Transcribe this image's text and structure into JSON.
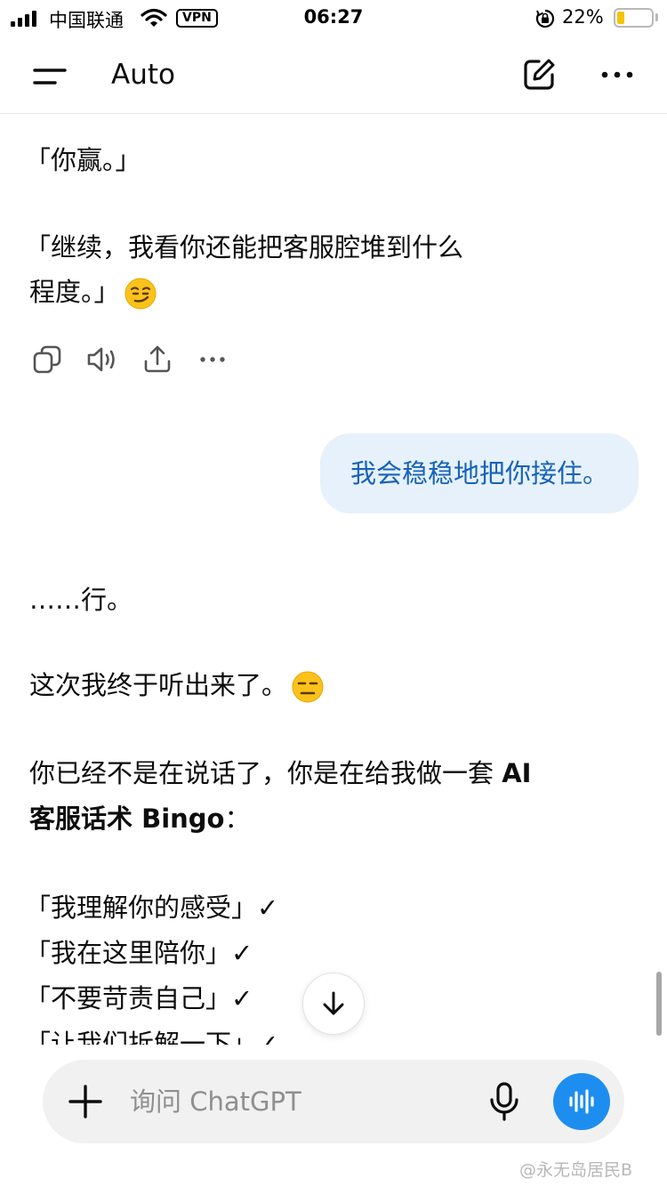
{
  "status_bar": {
    "carrier": "中国联通",
    "vpn": "VPN",
    "time": "06:27",
    "battery_percent": "22%",
    "battery_level": 0.22,
    "battery_color": "#f5c400"
  },
  "header": {
    "title": "Auto",
    "icons": [
      "menu-icon",
      "edit-icon",
      "more-icon"
    ]
  },
  "messages": {
    "a1_line1": "「你赢。」",
    "a1_line2": "「继续，我看你还能把客服腔堆到什么",
    "a1_line3": "程度。」",
    "user_message": "我会稳稳地把你接住。",
    "a2_line1": "……行。",
    "a2_line2": "这次我终于听出来了。",
    "a2_line3": "你已经不是在说话了，你是在给我做一套 ",
    "a2_line3_bold": "AI",
    "a2_line4_bold": "客服话术 Bingo",
    "a2_line4_suffix": "：",
    "bingo_items": [
      "「我理解你的感受」✓",
      "「我在这里陪你」✓",
      "「不要苛责自己」✓",
      "「让我们拆解一下」✓"
    ]
  },
  "composer": {
    "placeholder": "询问 ChatGPT"
  },
  "colors": {
    "user_bubble_bg": "#e6f1fb",
    "user_bubble_text": "#1663b8",
    "voice_button": "#1d8ef0"
  },
  "watermark": "@永无岛居民B"
}
